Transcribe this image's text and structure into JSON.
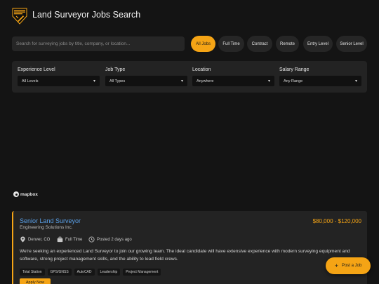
{
  "header": {
    "title": "Land Surveyor Jobs Search",
    "logo_icon": "surveyor-logo-icon"
  },
  "search": {
    "placeholder": "Search for surveying jobs by title, company, or location..."
  },
  "chips": [
    {
      "label": "All Jobs",
      "active": true
    },
    {
      "label": "Full Time",
      "active": false
    },
    {
      "label": "Contract",
      "active": false
    },
    {
      "label": "Remote",
      "active": false
    },
    {
      "label": "Entry Level",
      "active": false
    },
    {
      "label": "Senior Level",
      "active": false
    }
  ],
  "filters": [
    {
      "label": "Experience Level",
      "value": "All Levels"
    },
    {
      "label": "Job Type",
      "value": "All Types"
    },
    {
      "label": "Location",
      "value": "Anywhere"
    },
    {
      "label": "Salary Range",
      "value": "Any Range"
    }
  ],
  "map": {
    "attribution": "mapbox"
  },
  "job": {
    "title": "Senior Land Surveyor",
    "company": "Engineering Solutions Inc.",
    "salary": "$80,000 - $120,000",
    "location": "Denver, CO",
    "type": "Full Time",
    "posted": "Posted 2 days ago",
    "description": "We're seeking an experienced Land Surveyor to join our growing team. The ideal candidate will have extensive experience with modern surveying equipment and software, strong project management skills, and the ability to lead field crews.",
    "tags": [
      "Total Station",
      "GPS/GNSS",
      "AutoCAD",
      "Leadership",
      "Project Management"
    ],
    "apply_label": "Apply Now"
  },
  "post_button": {
    "label": "Post a Job"
  },
  "colors": {
    "accent": "#f5a415",
    "link": "#5aa0e8",
    "background": "#141414",
    "panel": "#232323"
  }
}
